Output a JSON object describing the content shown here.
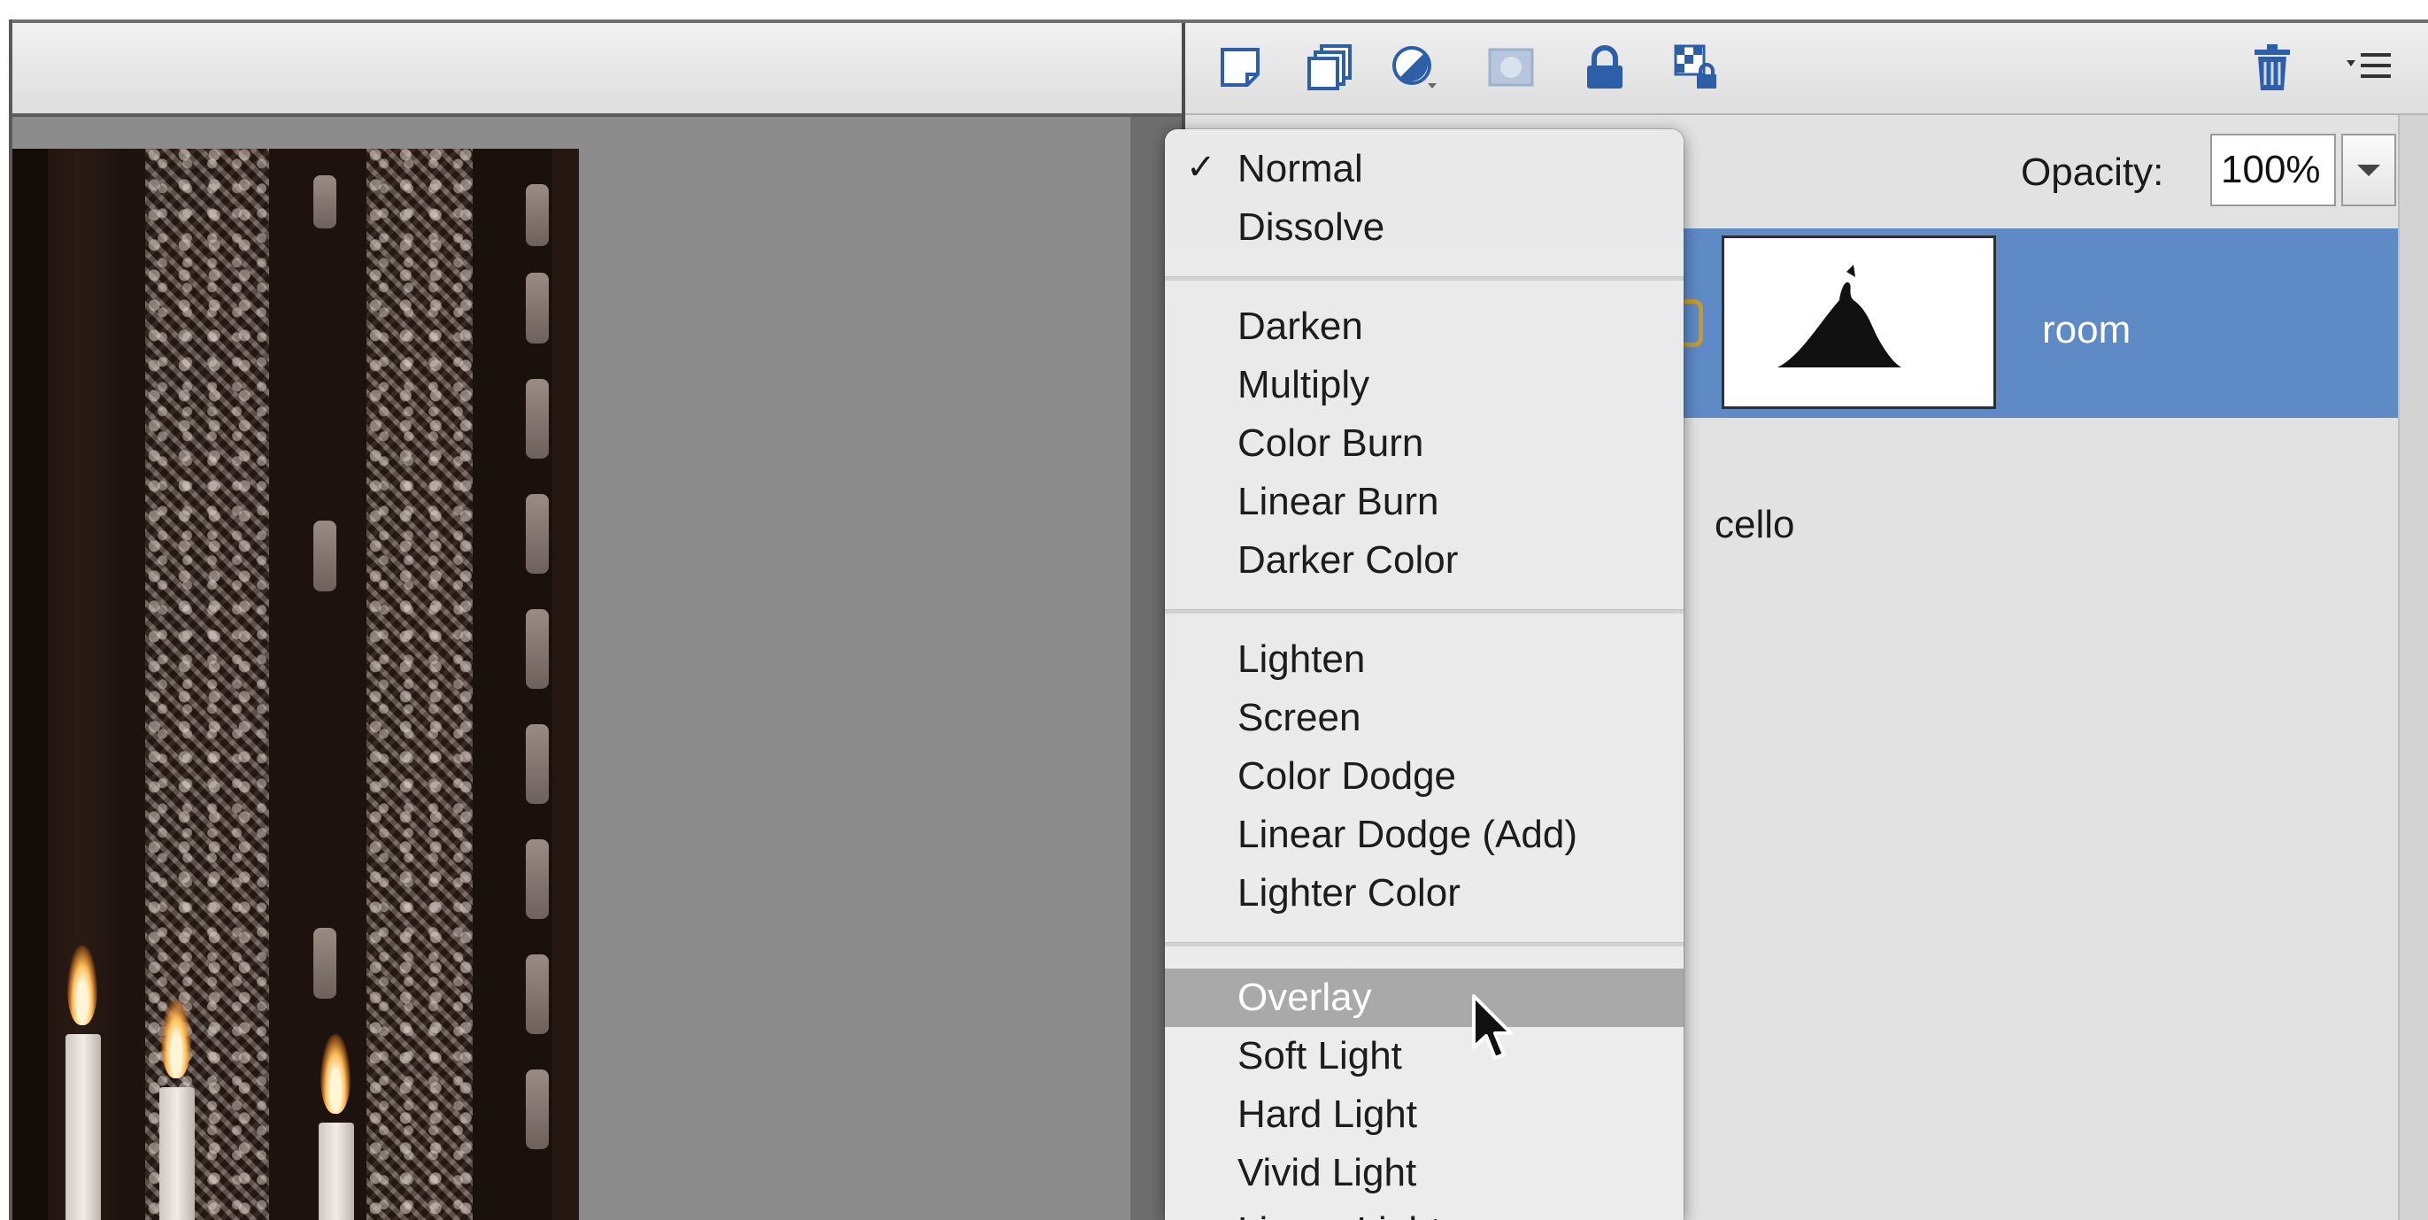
{
  "layers_panel": {
    "opacity_label": "Opacity:",
    "opacity_value": "100%",
    "layers": [
      {
        "name": "room",
        "selected": true
      },
      {
        "name": "cello",
        "selected": false
      }
    ]
  },
  "toolbar_icons": [
    "new-layer-icon",
    "new-group-icon",
    "adjustment-layer-icon",
    "layer-mask-icon",
    "lock-all-icon",
    "lock-transparency-icon",
    "trash-icon",
    "panel-menu-icon"
  ],
  "blend_menu": {
    "selected": "Normal",
    "hovered": "Overlay",
    "groups": [
      [
        "Normal",
        "Dissolve"
      ],
      [
        "Darken",
        "Multiply",
        "Color Burn",
        "Linear Burn",
        "Darker Color"
      ],
      [
        "Lighten",
        "Screen",
        "Color Dodge",
        "Linear Dodge (Add)",
        "Lighter Color"
      ],
      [
        "Overlay",
        "Soft Light",
        "Hard Light",
        "Vivid Light",
        "Linear Light"
      ]
    ]
  },
  "colors": {
    "selection_blue": "#5e8ac6",
    "menu_highlight": "#a9a9a9",
    "canvas_gray": "#8c8c8c"
  }
}
